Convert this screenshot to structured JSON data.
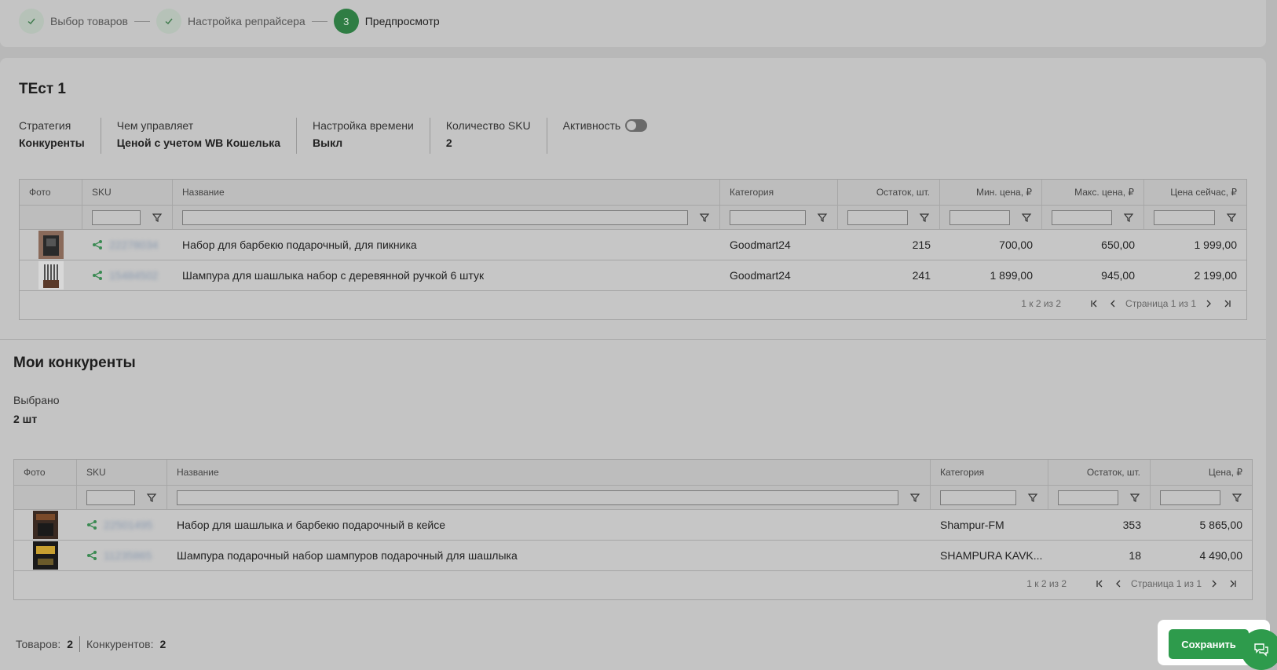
{
  "stepper": {
    "steps": [
      {
        "label": "Выбор товаров",
        "state": "done"
      },
      {
        "label": "Настройка репрайсера",
        "state": "done"
      },
      {
        "number": "3",
        "label": "Предпросмотр",
        "state": "active"
      }
    ]
  },
  "repricer": {
    "title": "ТЕст 1",
    "info": [
      {
        "label": "Стратегия",
        "value": "Конкуренты"
      },
      {
        "label": "Чем управляет",
        "value": "Ценой с учетом WB Кошелька"
      },
      {
        "label": "Настройка времени",
        "value": "Выкл"
      },
      {
        "label": "Количество SKU",
        "value": "2"
      },
      {
        "label": "Активность",
        "value": "",
        "toggle": "off"
      }
    ],
    "table": {
      "headers": [
        "Фото",
        "SKU",
        "Название",
        "Категория",
        "Остаток, шт.",
        "Мин. цена, ₽",
        "Макс. цена, ₽",
        "Цена сейчас, ₽"
      ],
      "rows": [
        {
          "sku": "22278034",
          "name": "Набор для барбекю подарочный, для пикника",
          "category": "Goodmart24",
          "stock": "215",
          "min": "700,00",
          "max": "650,00",
          "now": "1 999,00"
        },
        {
          "sku": "15484502",
          "name": "Шампура для шашлыка набор с деревянной ручкой 6 штук",
          "category": "Goodmart24",
          "stock": "241",
          "min": "1 899,00",
          "max": "945,00",
          "now": "2 199,00"
        }
      ],
      "pager": {
        "range": "1 к 2 из 2",
        "page": "Страница 1 из 1"
      }
    }
  },
  "competitors": {
    "title": "Мои конкуренты",
    "selected_label": "Выбрано",
    "selected_value": "2 шт",
    "table": {
      "headers": [
        "Фото",
        "SKU",
        "Название",
        "Категория",
        "Остаток, шт.",
        "Цена, ₽"
      ],
      "rows": [
        {
          "sku": "22501495",
          "name": "Набор для шашлыка и барбекю подарочный в кейсе",
          "category": "Shampur-FM",
          "stock": "353",
          "price": "5 865,00"
        },
        {
          "sku": "11235865",
          "name": "Шампура подарочный набор шампуров подарочный для шашлыка",
          "category": "SHAMPURA KAVK...",
          "stock": "18",
          "price": "4 490,00"
        }
      ],
      "pager": {
        "range": "1 к 2 из 2",
        "page": "Страница 1 из 1"
      }
    }
  },
  "footer": {
    "products_label": "Товаров:",
    "products_value": "2",
    "competitors_label": "Конкурентов:",
    "competitors_value": "2",
    "save_label": "Сохранить"
  },
  "colors": {
    "accent": "#2e9b4c",
    "overlay": "#b8b8b8"
  }
}
